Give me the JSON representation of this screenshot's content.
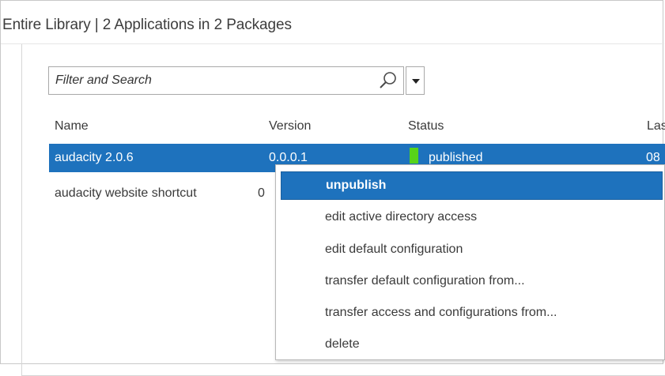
{
  "header": {
    "title": "Entire Library | 2 Applications in 2 Packages"
  },
  "search": {
    "placeholder": "Filter and Search",
    "value": ""
  },
  "table": {
    "columns": [
      "Name",
      "Version",
      "Status",
      "Las"
    ],
    "rows": [
      {
        "name": "audacity 2.0.6",
        "version": "0.0.0.1",
        "status": "published",
        "last": "08",
        "selected": true,
        "status_color": "#57d31a"
      },
      {
        "name": "audacity website shortcut",
        "version": "0",
        "status": "",
        "last": ""
      }
    ]
  },
  "context_menu": {
    "items": [
      {
        "label": "unpublish",
        "highlighted": true
      },
      {
        "label": "edit active directory access"
      },
      {
        "label": "edit default configuration"
      },
      {
        "label": "transfer default configuration from..."
      },
      {
        "label": "transfer access and configurations from..."
      },
      {
        "label": "delete"
      }
    ]
  },
  "colors": {
    "selection": "#1e72bd",
    "status_published": "#57d31a"
  }
}
